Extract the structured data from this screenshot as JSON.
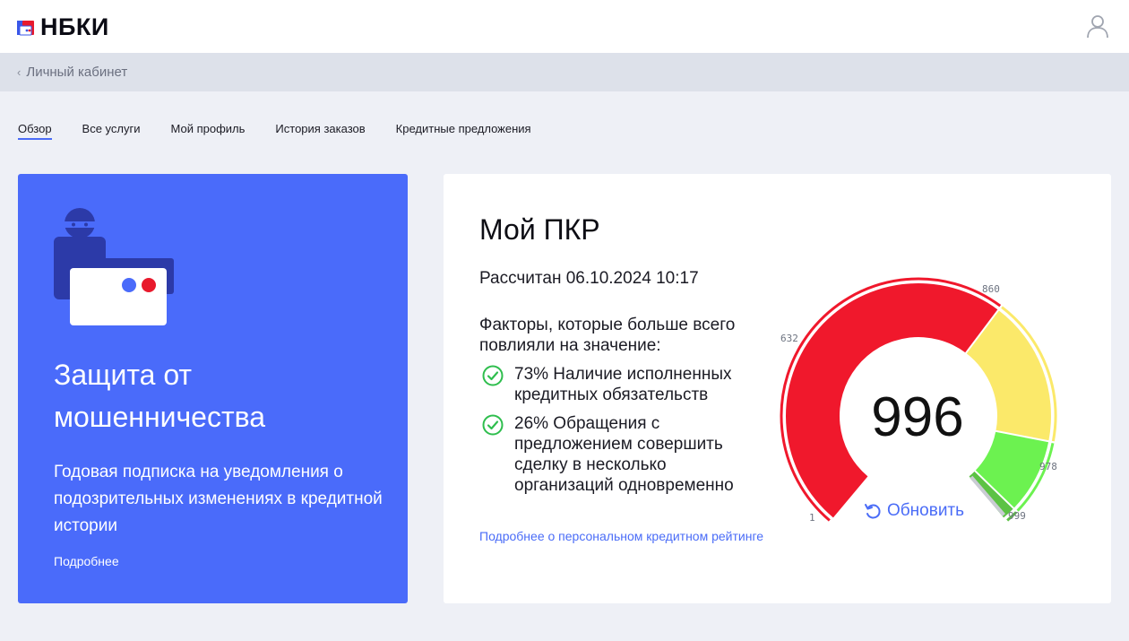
{
  "header": {
    "logo_text": "НБКИ",
    "brand_colors": {
      "red": "#e8192c",
      "blue": "#3a57e8"
    }
  },
  "breadcrumb": {
    "label": "Личный кабинет"
  },
  "tabs": [
    {
      "label": "Обзор",
      "active": true
    },
    {
      "label": "Все услуги"
    },
    {
      "label": "Мой профиль"
    },
    {
      "label": "История заказов"
    },
    {
      "label": "Кредитные предложения"
    }
  ],
  "promo": {
    "title": "Защита от мошенничества",
    "text": "Годовая подписка на уведомления о подозрительных изменениях в кредитной истории",
    "link": "Подробнее",
    "background": "#4a6bfa"
  },
  "pkr": {
    "title": "Мой ПКР",
    "calculated": "Рассчитан 06.10.2024 10:17",
    "factors_heading": "Факторы, которые больше всего повлияли на значение:",
    "factors": [
      {
        "text": "73% Наличие исполненных кредитных обязательств"
      },
      {
        "text": "26% Обращения с предложением совершить сделку в несколько организаций одновременно"
      }
    ],
    "more_link": "Подробнее о персональном кредитном рейтинге",
    "score": "996",
    "refresh_label": "Обновить",
    "gauge": {
      "min": 1,
      "max": 999,
      "value": 996,
      "ticks": [
        "1",
        "632",
        "860",
        "978",
        "999"
      ],
      "zones": [
        {
          "from": 1,
          "to": 632,
          "color": "#f0182c"
        },
        {
          "from": 632,
          "to": 860,
          "color": "#fbe96a"
        },
        {
          "from": 860,
          "to": 978,
          "color": "#6cf250"
        },
        {
          "from": 978,
          "to": 999,
          "color": "#5cc244"
        }
      ]
    }
  }
}
